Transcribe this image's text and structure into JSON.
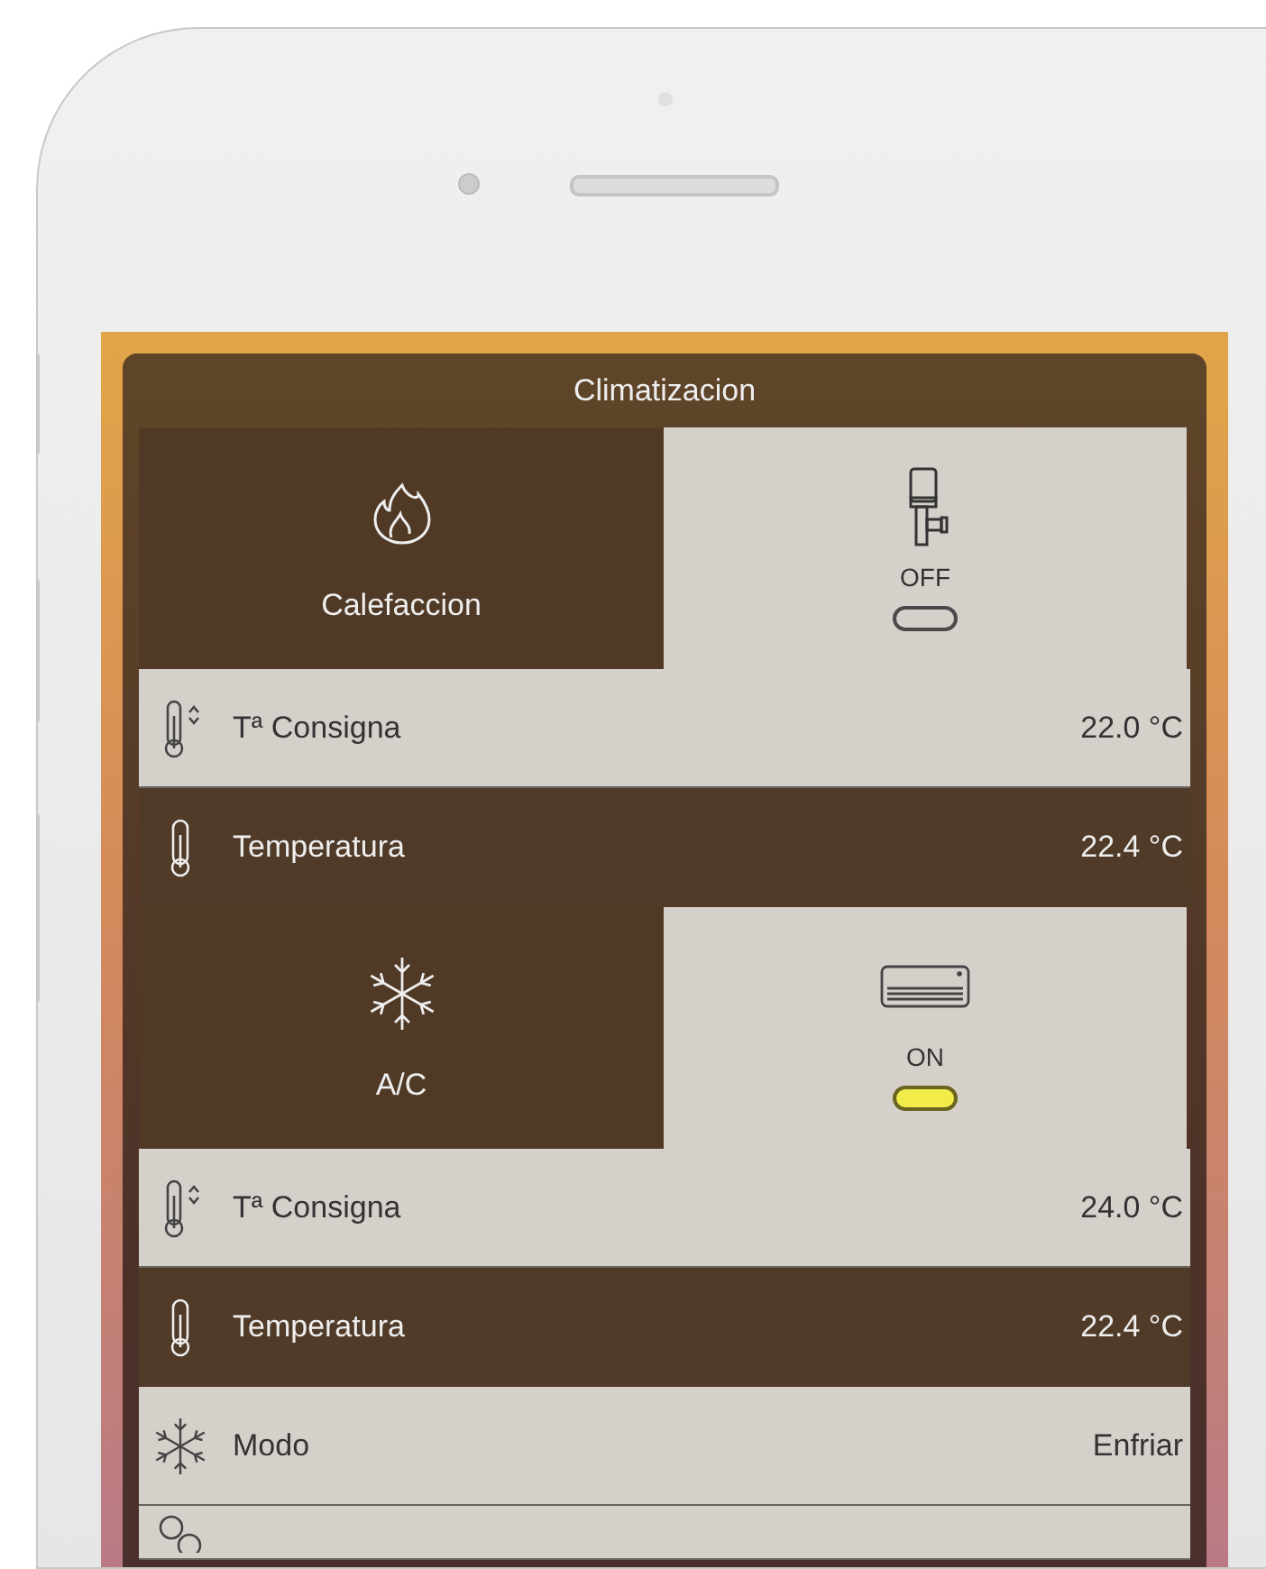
{
  "panel": {
    "title": "Climatizacion"
  },
  "groups": [
    {
      "label": "Calefaccion",
      "kind": "heating",
      "status": "OFF",
      "on": false,
      "rows": [
        {
          "kind": "setpoint",
          "label": "Tª Consigna",
          "value": "22.0 °C"
        },
        {
          "kind": "temperature",
          "label": "Temperatura",
          "value": "22.4 °C"
        }
      ]
    },
    {
      "label": "A/C",
      "kind": "cooling",
      "status": "ON",
      "on": true,
      "rows": [
        {
          "kind": "setpoint",
          "label": "Tª Consigna",
          "value": "24.0 °C"
        },
        {
          "kind": "temperature",
          "label": "Temperatura",
          "value": "22.4 °C"
        },
        {
          "kind": "mode",
          "label": "Modo",
          "value": "Enfriar"
        },
        {
          "kind": "fan"
        }
      ]
    }
  ]
}
